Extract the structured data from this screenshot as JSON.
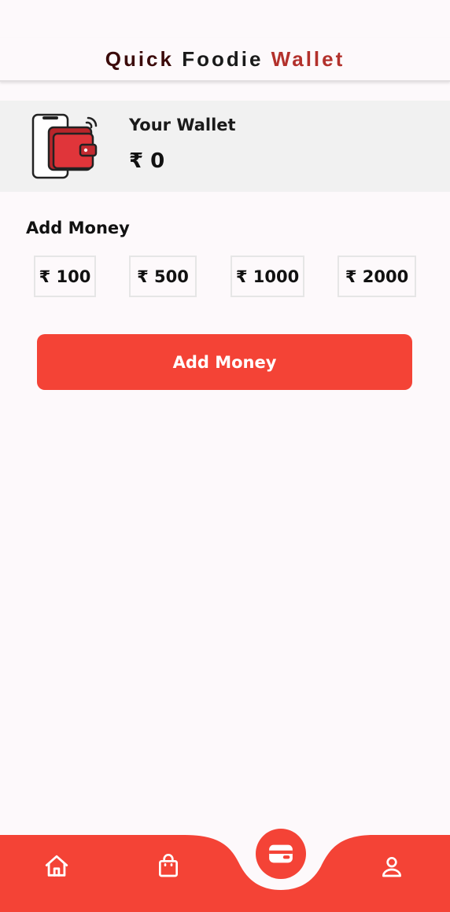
{
  "header": {
    "title_parts": [
      "Quick",
      "Foodie",
      "Wallet"
    ]
  },
  "wallet": {
    "label": "Your Wallet",
    "balance": "₹ 0",
    "illustration_icon": "wallet-phone-icon"
  },
  "add_money": {
    "section_title": "Add Money",
    "amounts": [
      "₹ 100",
      "₹ 500",
      "₹ 1000",
      "₹ 2000"
    ],
    "button_label": "Add Money"
  },
  "nav": {
    "items": [
      "home-icon",
      "shopping-bag-icon",
      "wallet-icon",
      "profile-icon"
    ]
  },
  "colors": {
    "accent": "#f44336",
    "background": "#fdf9fb",
    "card": "#f1f1f1"
  }
}
